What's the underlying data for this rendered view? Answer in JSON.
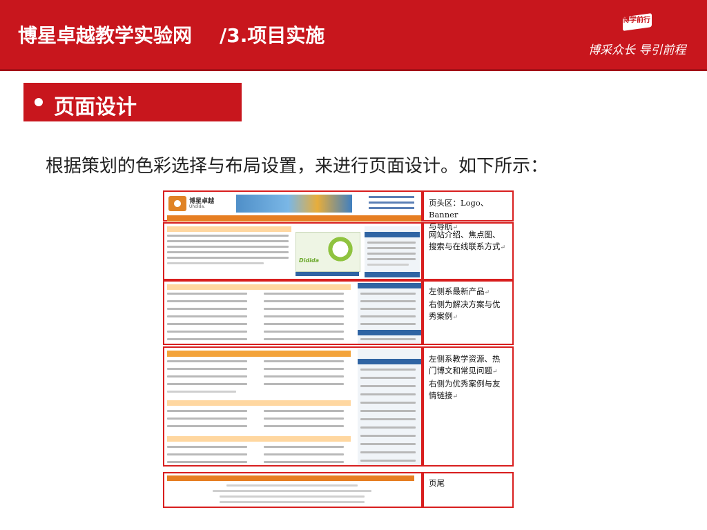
{
  "header": {
    "site": "博星卓越教学实验网",
    "section": "/3.项目实施",
    "logo_text": "博学前行",
    "slogan": "博采众长 导引前程"
  },
  "section_title": "页面设计",
  "intro": "根据策划的色彩选择与布局设置，来进行页面设计。如下所示：",
  "mockup": {
    "site_name": "博星卓越",
    "site_sub": "Uhdida.",
    "promo": "Didida"
  },
  "annotations": [
    {
      "lines": [
        "页头区：Logo、Banner",
        "与导航"
      ]
    },
    {
      "lines": [
        "网站介绍、焦点图、",
        "搜索与在线联系方式"
      ]
    },
    {
      "lines": [
        "左侧系最新产品",
        "右侧为解决方案与优",
        "秀案例"
      ]
    },
    {
      "lines": [
        "左侧系教学资源、热",
        "门博文和常见问题",
        "右侧为优秀案例与友",
        "情链接"
      ]
    },
    {
      "lines": [
        "页尾"
      ]
    }
  ],
  "return_mark": "↵"
}
